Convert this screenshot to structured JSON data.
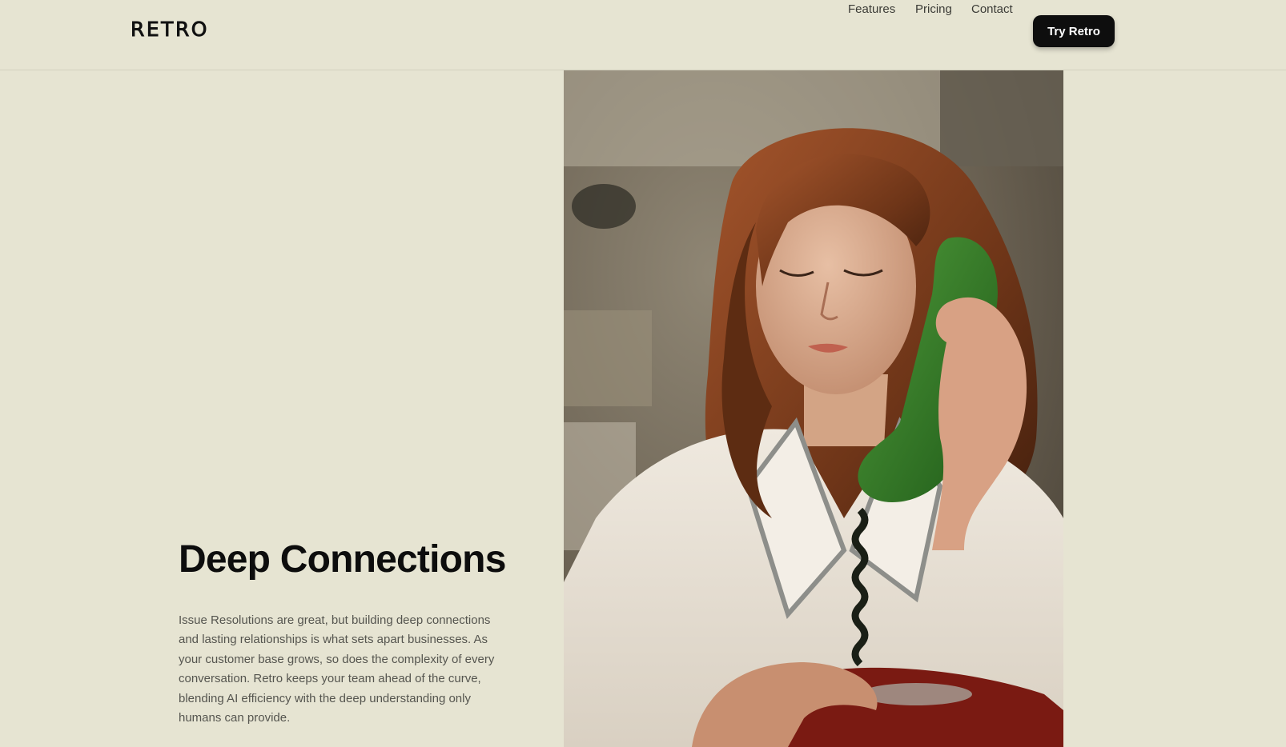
{
  "brand": {
    "logo_text": "RETRO"
  },
  "nav": {
    "items": [
      {
        "label": "Features"
      },
      {
        "label": "Pricing"
      },
      {
        "label": "Contact"
      }
    ],
    "cta_label": "Try Retro"
  },
  "hero": {
    "title": "Deep Connections",
    "body": "Issue Resolutions are great, but building deep connections and lasting relationships is what sets apart businesses. As your customer base grows, so does the complexity of every conversation. Retro keeps your team ahead of the curve, blending AI efficiency with the deep understanding only humans can provide."
  },
  "colors": {
    "background": "#e6e4d2",
    "cta_background": "#0e0e0e",
    "cta_text": "#ffffff",
    "heading": "#0d0d0d",
    "body_text": "#55554f"
  },
  "icons": {
    "photo": "woman-on-green-rotary-phone-photo"
  }
}
